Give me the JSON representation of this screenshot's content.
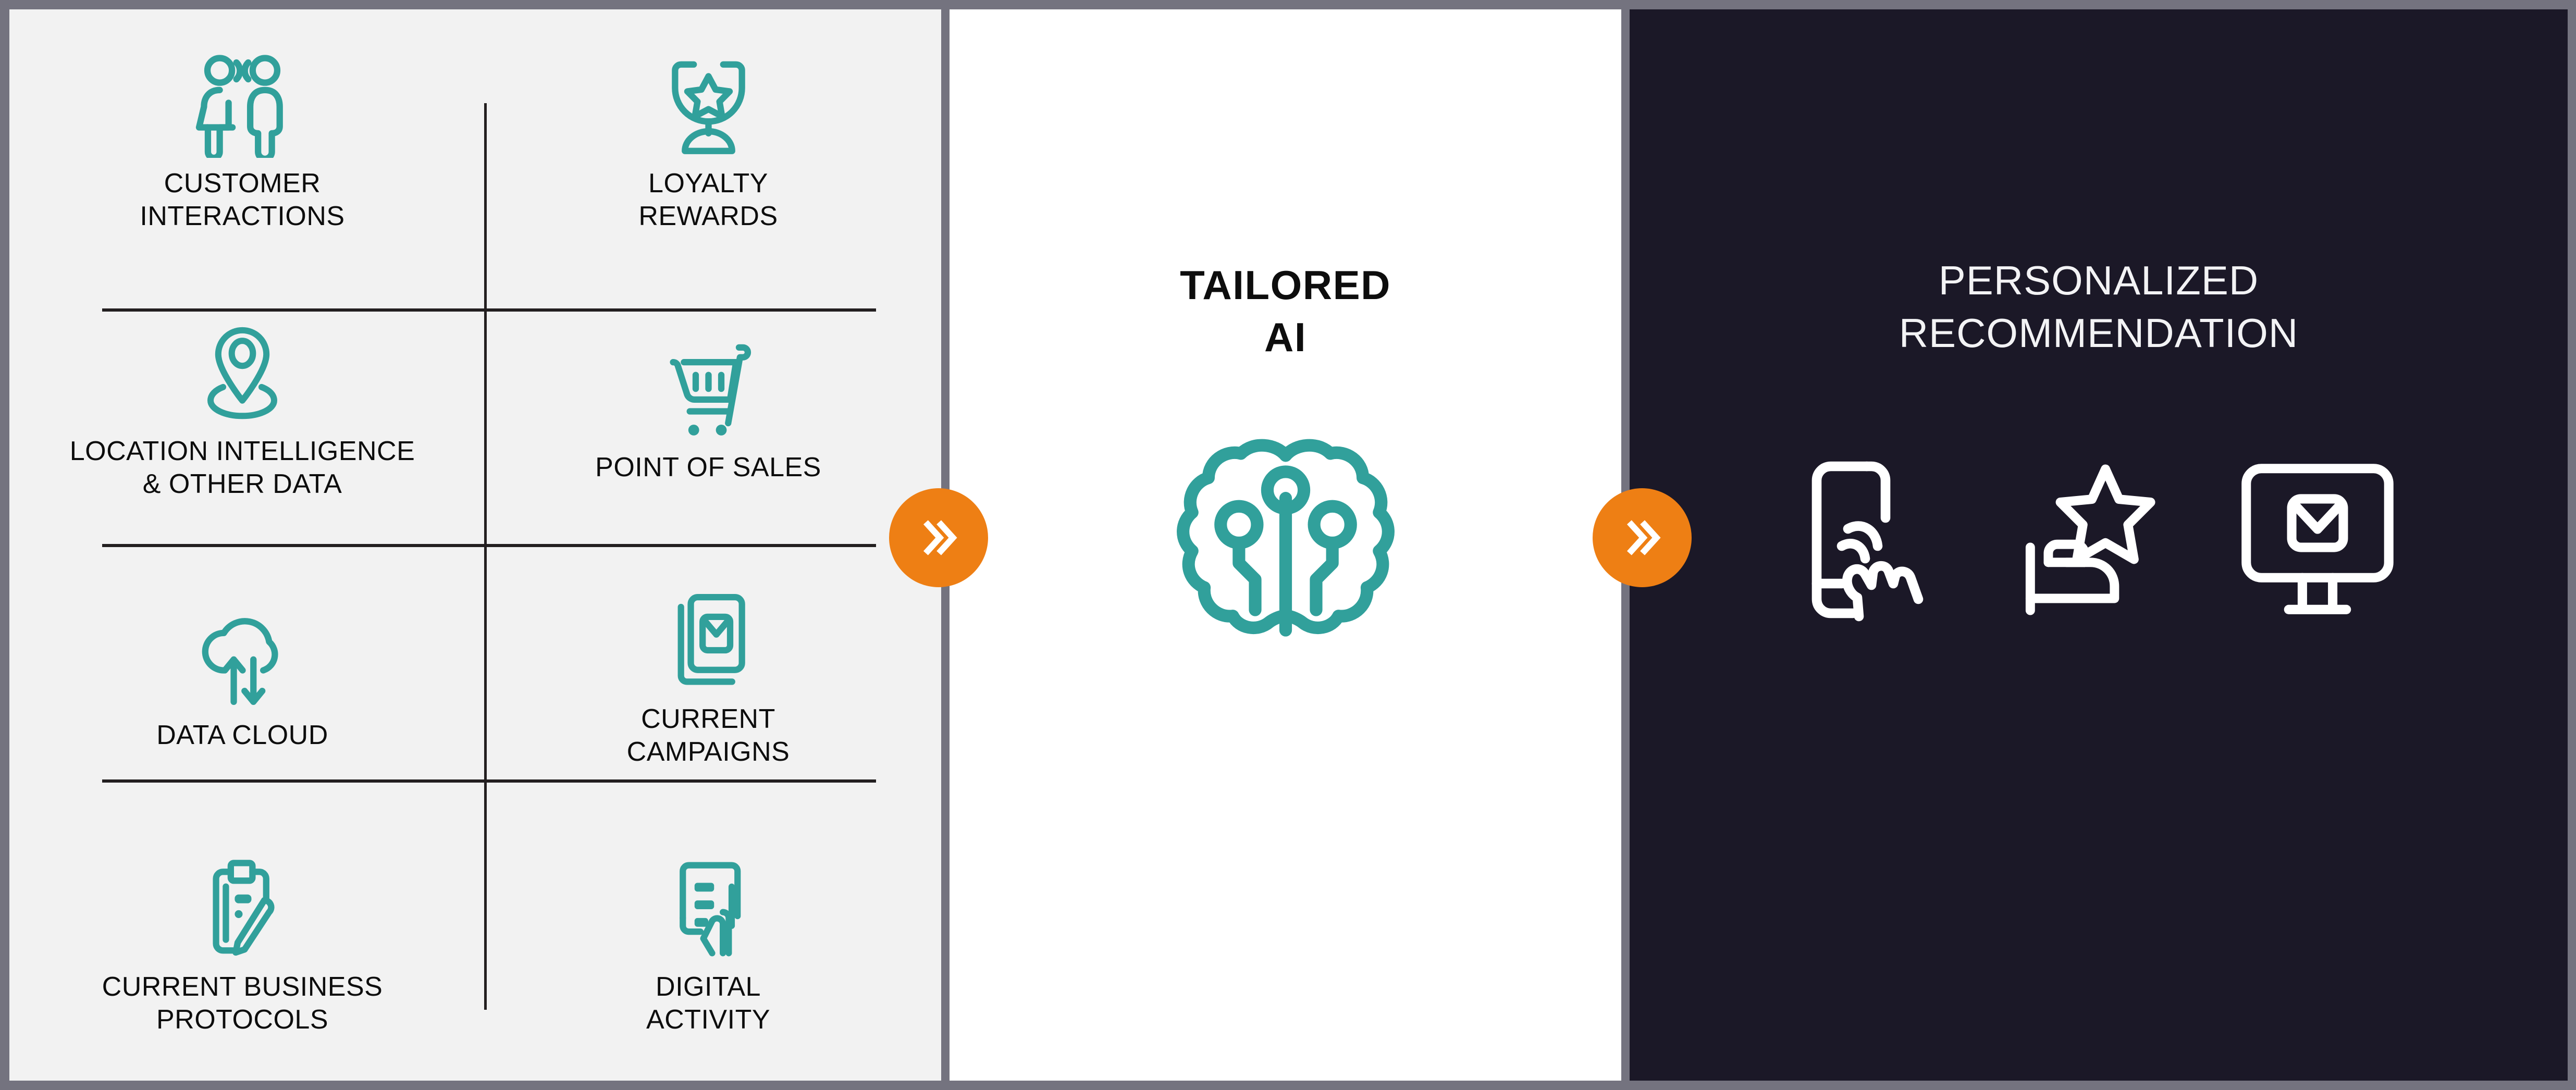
{
  "colors": {
    "outer_border": "#74737f",
    "left_panel_bg": "#f2f2f2",
    "center_panel_bg": "#ffffff",
    "right_panel_bg": "#1b1827",
    "teal_icon": "#31a09b",
    "orange_accent": "#ee7f14",
    "divider_line": "#231f20",
    "dark_text": "#0d0d0d",
    "light_text": "#f3f3f5"
  },
  "left_panel": {
    "items": [
      {
        "label": "CUSTOMER\nINTERACTIONS",
        "icon": "two-people-speaking-icon"
      },
      {
        "label": "LOYALTY\nREWARDS",
        "icon": "trophy-star-icon"
      },
      {
        "label": "LOCATION INTELLIGENCE\n& OTHER DATA",
        "icon": "map-pin-icon"
      },
      {
        "label": "POINT OF SALES",
        "icon": "shopping-cart-icon"
      },
      {
        "label": "DATA CLOUD",
        "icon": "cloud-sync-arrows-icon"
      },
      {
        "label": "CURRENT\nCAMPAIGNS",
        "icon": "stacked-email-icon"
      },
      {
        "label": "CURRENT BUSINESS\nPROTOCOLS",
        "icon": "clipboard-pen-icon"
      },
      {
        "label": "DIGITAL\nACTIVITY",
        "icon": "tablet-touch-icon"
      }
    ]
  },
  "center_panel": {
    "title": "TAILORED\nAI",
    "icon": "ai-brain-circuit-icon"
  },
  "right_panel": {
    "title": "PERSONALIZED\nRECOMMENDATION",
    "icons": [
      {
        "name": "phone-touch-gesture-icon"
      },
      {
        "name": "bed-star-rating-icon"
      },
      {
        "name": "monitor-email-icon"
      }
    ]
  },
  "arrows": [
    {
      "name": "double-chevron-right-1",
      "glyph": "»"
    },
    {
      "name": "double-chevron-right-2",
      "glyph": "»"
    }
  ]
}
